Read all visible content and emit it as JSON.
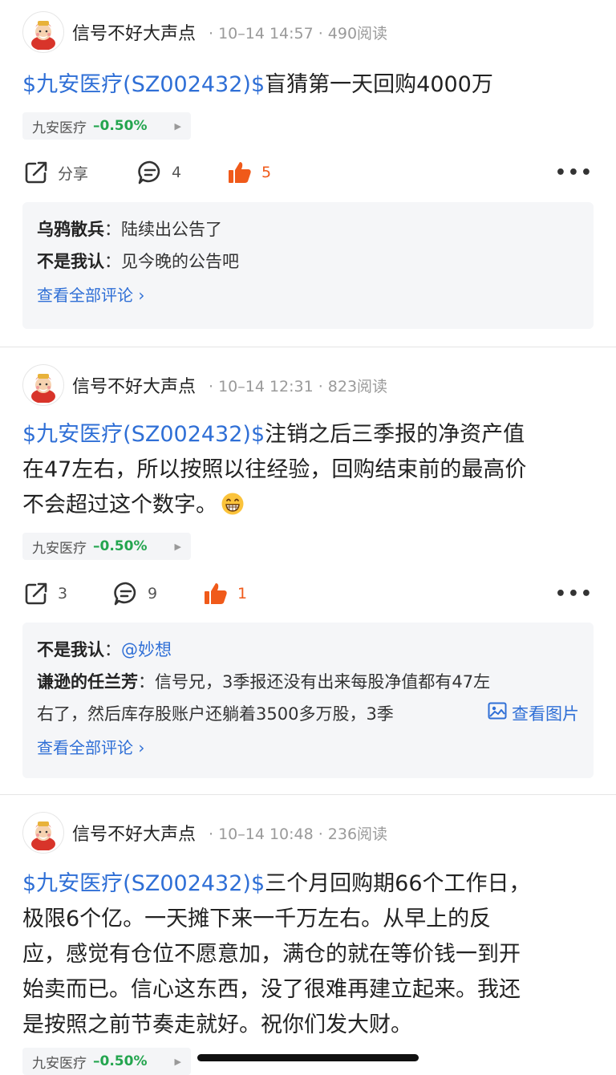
{
  "posts": [
    {
      "author": "信号不好大声点",
      "time": "10–14 14:57",
      "reads": "490阅读",
      "stock_link": "$九安医疗(SZ002432)$",
      "text": "盲猜第一天回购4000万",
      "tag": {
        "name": "九安医疗",
        "change": "–0.50%"
      },
      "share_label": "分享",
      "comment_count": "4",
      "like_count": "5",
      "comments": [
        {
          "user": "乌鸦散兵",
          "sep": "：",
          "text": "陆续出公告了"
        },
        {
          "user": "不是我认",
          "sep": "：",
          "text": "见今晚的公告吧"
        }
      ],
      "view_all": "查看全部评论 ›"
    },
    {
      "author": "信号不好大声点",
      "time": "10–14 12:31",
      "reads": "823阅读",
      "stock_link": "$九安医疗(SZ002432)$",
      "text_line1": "注销之后三季报的净资产值",
      "text_line2": "在47左右，所以按照以往经验，回购结束前的最高价",
      "text_line3": "不会超过这个数字。",
      "tag": {
        "name": "九安医疗",
        "change": "–0.50%"
      },
      "share_count": "3",
      "comment_count": "9",
      "like_count": "1",
      "comments": [
        {
          "user": "不是我认",
          "sep": "：",
          "mention": "@妙想"
        },
        {
          "user": "谦逊的任兰芳",
          "sep": "：",
          "text_line1": "信号兄，3季报还没有出来每股净值都有47左",
          "text_line2": "右了，然后库存股账户还躺着3500多万股，3季",
          "image_label": "查看图片"
        }
      ],
      "view_all": "查看全部评论 ›"
    },
    {
      "author": "信号不好大声点",
      "time": "10–14 10:48",
      "reads": "236阅读",
      "stock_link": "$九安医疗(SZ002432)$",
      "text_line1": "三个月回购期66个工作日，",
      "text_line2": "极限6个亿。一天摊下来一千万左右。从早上的反",
      "text_line3": "应，感觉有仓位不愿意加，满仓的就在等价钱一到开",
      "text_line4": "始卖而已。信心这东西，没了很难再建立起来。我还",
      "text_line5": "是按照之前节奏走就好。祝你们发大财。",
      "tag": {
        "name": "九安医疗",
        "change": "–0.50%"
      }
    }
  ],
  "colors": {
    "link": "#2f6fd6",
    "like": "#f05a1a",
    "down": "#24a54f"
  },
  "icons": [
    "avatar-god-of-wealth",
    "share-icon",
    "comment-icon",
    "thumbs-up-icon",
    "more-icon",
    "image-icon",
    "grin-emoji"
  ]
}
